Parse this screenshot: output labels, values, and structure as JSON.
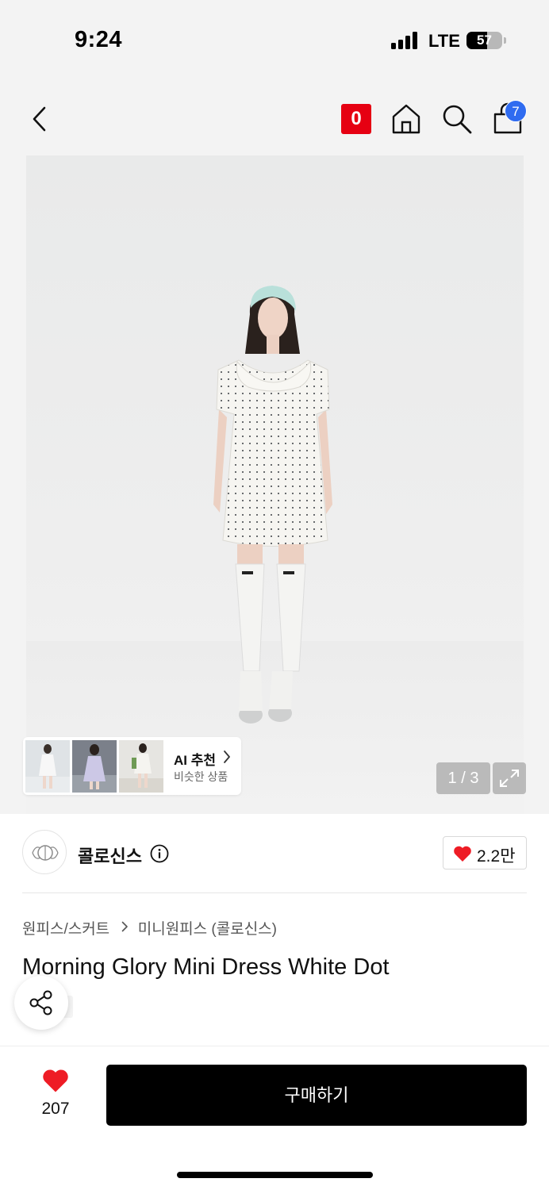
{
  "status_bar": {
    "time": "9:24",
    "network": "LTE",
    "battery": "57",
    "battery_level": 0.57
  },
  "nav": {
    "badge": "0",
    "cart_count": "7"
  },
  "gallery": {
    "ai_title": "AI 추천",
    "ai_subtitle": "비슷한 상품",
    "page_indicator": "1 / 3"
  },
  "brand": {
    "name": "콜로신스",
    "likes": "2.2만"
  },
  "product": {
    "category": "원피스/스커트",
    "subcategory": "미니원피스 (콜로신스)",
    "title": "Morning Glory Mini Dress White Dot"
  },
  "purchase": {
    "likes": "207",
    "buy_label": "구매하기"
  },
  "colors": {
    "accent_red": "#e60012",
    "heart_red": "#ee1c25",
    "cart_badge_blue": "#2f6bf0",
    "buy_button": "#000000"
  }
}
